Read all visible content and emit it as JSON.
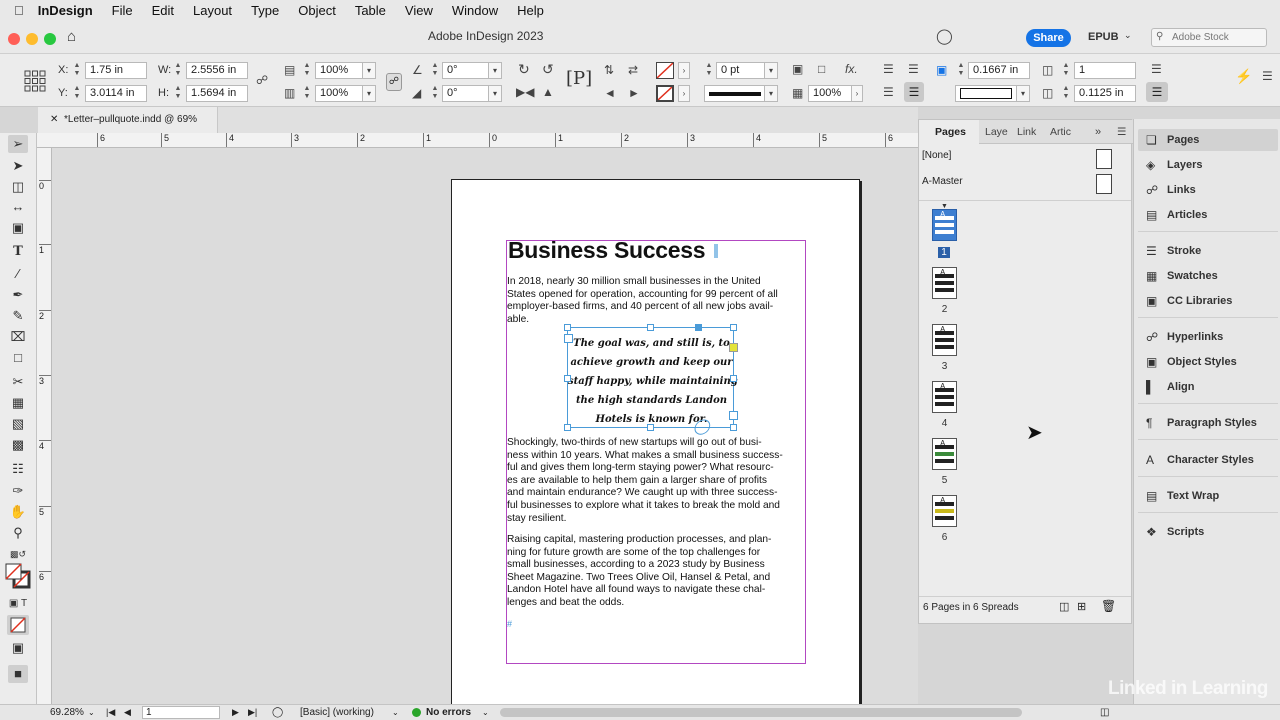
{
  "menubar": {
    "app": "InDesign",
    "items": [
      "File",
      "Edit",
      "Layout",
      "Type",
      "Object",
      "Table",
      "View",
      "Window",
      "Help"
    ]
  },
  "titlebar": {
    "title": "Adobe InDesign 2023",
    "share_label": "Share",
    "workspace_label": "EPUB",
    "stock_placeholder": "Adobe Stock"
  },
  "control": {
    "x_label": "X:",
    "x_value": "1.75 in",
    "y_label": "Y:",
    "y_value": "3.0114 in",
    "w_label": "W:",
    "w_value": "2.5556 in",
    "h_label": "H:",
    "h_value": "1.5694 in",
    "scale_x": "100%",
    "scale_y": "100%",
    "rotate": "0°",
    "shear": "0°",
    "stroke_weight": "0 pt",
    "opacity": "100%",
    "fx": "fx.",
    "inset": "0.1667 in",
    "columns": "1",
    "gutter": "0.1125 in"
  },
  "document": {
    "tab_label": "*Letter–pullquote.indd @ 69%",
    "headline": "Business Success",
    "para1": "In 2018, nearly 30 million small businesses in the United\nStates opened for operation, accounting for 99 percent of all\nemployer-based firms, and 40 percent of all new jobs avail-\nable.",
    "pullquote": "The goal was, and still is, to\nachieve growth and keep our\nstaff happy, while maintaining\nthe high standards Landon\nHotels is known for.",
    "para2": "Shockingly, two-thirds of new startups will go out of busi-\nness within 10 years. What makes a small business success-\nful and gives them long-term staying power? What resourc-\nes are available to help them gain a larger share of profits\nand maintain endurance? We caught up with three success-\nful businesses to explore what it takes to break the mold and\nstay resilient.",
    "para3": "Raising capital, mastering production processes, and plan-\nning for future growth are some of the top challenges for\nsmall businesses, according to a 2023 study by Business\nSheet Magazine. Two Trees Olive Oil, Hansel & Petal, and\nLandon Hotel have all found ways to navigate these chal-\nlenges and beat the odds."
  },
  "rulers": {
    "top": [
      "6",
      "5",
      "4",
      "3",
      "2",
      "1",
      "0",
      "1",
      "2",
      "3",
      "4",
      "5",
      "6",
      "7"
    ],
    "left": [
      "0",
      "1",
      "2",
      "3",
      "4",
      "5",
      "6"
    ]
  },
  "pages_panel": {
    "tabs": [
      "Pages",
      "Laye",
      "Link",
      "Artic"
    ],
    "masters": [
      "[None]",
      "A-Master"
    ],
    "pages": [
      "1",
      "2",
      "3",
      "4",
      "5",
      "6"
    ],
    "footer": "6 Pages in 6 Spreads"
  },
  "dock": {
    "items": [
      "Pages",
      "Layers",
      "Links",
      "Articles",
      "Stroke",
      "Swatches",
      "CC Libraries",
      "Hyperlinks",
      "Object Styles",
      "Align",
      "Paragraph Styles",
      "Character Styles",
      "Text Wrap",
      "Scripts"
    ]
  },
  "status": {
    "zoom": "69.28%",
    "page": "1",
    "profile": "[Basic] (working)",
    "errors": "No errors"
  },
  "watermark": "Linked in Learning",
  "colors": {
    "accent": "#1473e6",
    "frame": "#4a9bd8",
    "margin": "#b248c1",
    "ok": "#2aa52a"
  }
}
